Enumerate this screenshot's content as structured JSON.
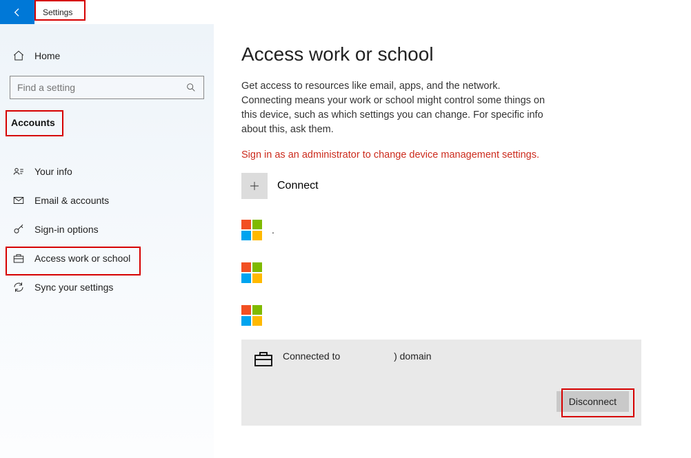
{
  "app_title": "Settings",
  "sidebar": {
    "home": "Home",
    "search_placeholder": "Find a setting",
    "section": "Accounts",
    "items": [
      {
        "label": "Your info"
      },
      {
        "label": "Email & accounts"
      },
      {
        "label": "Sign-in options"
      },
      {
        "label": "Access work or school"
      },
      {
        "label": "Sync your settings"
      }
    ]
  },
  "main": {
    "title": "Access work or school",
    "description": "Get access to resources like email, apps, and the network. Connecting means your work or school might control some things on this device, such as which settings you can change. For specific info about this, ask them.",
    "warning": "Sign in as an administrator to change device management settings.",
    "connect_label": "Connect",
    "accounts": [
      {
        "text": "."
      },
      {
        "text": ""
      },
      {
        "text": ""
      }
    ],
    "domain": {
      "prefix": "Connected to",
      "suffix": ") domain",
      "disconnect": "Disconnect"
    }
  }
}
